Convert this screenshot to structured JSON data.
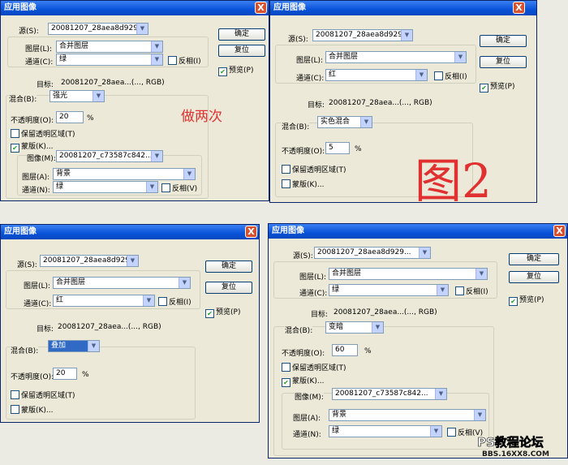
{
  "title": "应用图像",
  "close": "X",
  "labels": {
    "source": "源(S):",
    "layer": "图层(L):",
    "channel": "通道(C):",
    "invert": "反相(I)",
    "target_label": "目标:",
    "blend": "混合(B):",
    "opacity": "不透明度(O):",
    "percent": "%",
    "preserve": "保留透明区域(T)",
    "mask": "蒙版(K)...",
    "image": "图像(M):",
    "mlayer": "图层(A):",
    "mchannel": "通道(N):",
    "minvert": "反相(V)",
    "ok": "确定",
    "reset": "复位",
    "preview": "预览(P)"
  },
  "dialogs": [
    {
      "source": "20081207_28aea8d929...",
      "layer": "合并图层",
      "channel": "绿",
      "target": "20081207_28aea...(..., RGB)",
      "blend": "强光",
      "opacity": "20",
      "mask_checked": true,
      "preview_checked": true,
      "mask_image": "20081207_c73587c842...",
      "mask_layer": "背景",
      "mask_channel": "绿"
    },
    {
      "source": "20081207_28aea8d929...",
      "layer": "合并图层",
      "channel": "红",
      "target": "20081207_28aea...(..., RGB)",
      "blend": "实色混合",
      "opacity": "5",
      "mask_checked": false,
      "preview_checked": true
    },
    {
      "source": "20081207_28aea8d929...",
      "layer": "合并图层",
      "channel": "红",
      "target": "20081207_28aea...(..., RGB)",
      "blend": "叠加",
      "opacity": "20",
      "mask_checked": false,
      "preview_checked": true
    },
    {
      "source": "20081207_28aea8d929...",
      "layer": "合并图层",
      "channel": "绿",
      "target": "20081207_28aea...(..., RGB)",
      "blend": "变暗",
      "opacity": "60",
      "mask_checked": true,
      "preview_checked": true,
      "mask_image": "20081207_c73587c842...",
      "mask_layer": "背景",
      "mask_channel": "绿"
    }
  ],
  "annotations": {
    "twice": "做两次",
    "fig2": "图2"
  },
  "watermark": {
    "line1": "PS教程论坛",
    "line2": "BBS.16XX8.COM"
  },
  "colors": {
    "titlebar": "#0a52d8",
    "annotation": "#e03030",
    "dialog_bg": "#ece9d8"
  }
}
